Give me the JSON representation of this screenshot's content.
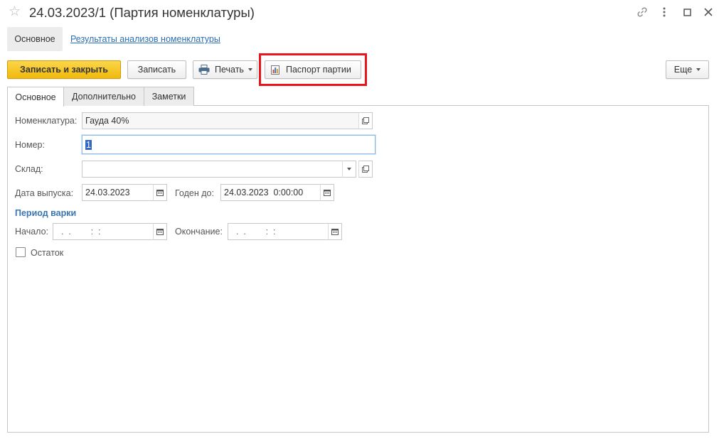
{
  "window": {
    "title": "24.03.2023/1 (Партия номенклатуры)"
  },
  "nav": {
    "main_label": "Основное",
    "link_label": "Результаты анализов номенклатуры"
  },
  "toolbar": {
    "save_close_label": "Записать и закрыть",
    "save_label": "Записать",
    "print_label": "Печать",
    "passport_label": "Паспорт партии",
    "more_label": "Еще"
  },
  "tabs": [
    {
      "label": "Основное",
      "active": true
    },
    {
      "label": "Дополнительно",
      "active": false
    },
    {
      "label": "Заметки",
      "active": false
    }
  ],
  "form": {
    "nomenclature_label": "Номенклатура:",
    "nomenclature_value": "Гауда 40%",
    "number_label": "Номер:",
    "number_value": "1",
    "warehouse_label": "Склад:",
    "warehouse_value": "",
    "release_date_label": "Дата выпуска:",
    "release_date_value": "24.03.2023",
    "valid_until_label": "Годен до:",
    "valid_until_value": "24.03.2023  0:00:00",
    "period_title": "Период варки",
    "start_label": "Начало:",
    "start_value": "  .  .        :  :",
    "end_label": "Окончание:",
    "end_value": "  .  .        :  :",
    "remainder_label": "Остаток",
    "remainder_checked": false
  },
  "colors": {
    "primary_button": "#f0b90c",
    "link": "#2a6fb2",
    "group_title": "#3a75b0",
    "highlight": "#e8151b"
  }
}
